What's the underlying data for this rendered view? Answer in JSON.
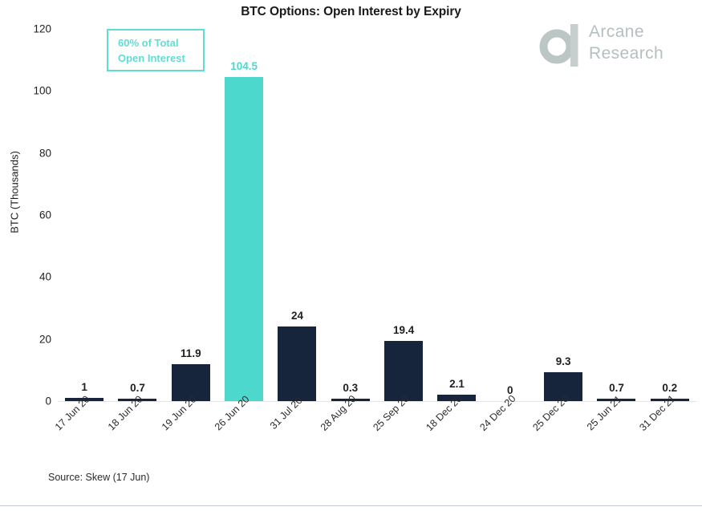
{
  "chart_data": {
    "type": "bar",
    "title": "BTC Options: Open Interest by Expiry",
    "xlabel": "",
    "ylabel": "BTC (Thousands)",
    "ylim": [
      0,
      120
    ],
    "yticks": [
      120,
      100,
      80,
      60,
      40,
      20,
      0
    ],
    "grid": false,
    "legend": null,
    "categories": [
      "17 Jun 20",
      "18 Jun 20",
      "19 Jun 20",
      "26 Jun 20",
      "31 Jul 20",
      "28 Aug 20",
      "25 Sep 20",
      "18 Dec 20",
      "24 Dec 20",
      "25 Dec 20",
      "25 Jun 21",
      "31 Dec 21"
    ],
    "values": [
      1,
      0.7,
      11.9,
      104.5,
      24,
      0.3,
      19.4,
      2.1,
      0,
      9.3,
      0.7,
      0.2
    ],
    "value_labels": [
      "1",
      "0.7",
      "11.9",
      "104.5",
      "24",
      "0.3",
      "19.4",
      "2.1",
      "0",
      "9.3",
      "0.7",
      "0.2"
    ],
    "highlight_index": 3,
    "colors": {
      "bar": "#16243c",
      "bar_highlight": "#4dd8ce",
      "label": "#1f1f1f",
      "label_highlight": "#4dd8ce",
      "axis": "#e3e5e7"
    },
    "annotations": [
      {
        "name": "share-of-total-callout",
        "line1": "60% of Total",
        "line2": "Open Interest",
        "color": "#5fddd5"
      }
    ]
  },
  "footer": {
    "source": "Source: Skew (17 Jun)"
  },
  "brand": {
    "logo_icon": "arcane-a-mark-icon",
    "line1": "Arcane",
    "line2": "Research",
    "color": "#b6bfc0"
  }
}
